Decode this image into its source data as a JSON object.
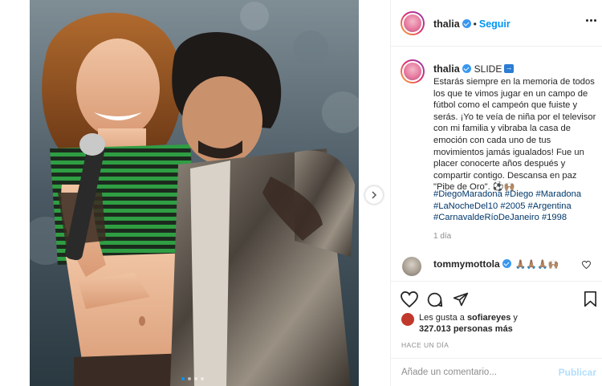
{
  "photo": {
    "slides_total": 4,
    "slide_active": 1
  },
  "header": {
    "username": "thalia",
    "separator": "•",
    "follow_label": "Seguir"
  },
  "caption": {
    "username": "thalia",
    "slide_label": "SLIDE",
    "text": "Estarás siempre en la memoria de todos los que te vimos jugar en un campo de fútbol como el campeón que fuiste y serás. ¡Yo te veía de niña por el televisor con mi familia y vibraba la casa de emoción con cada uno de tus movimientos jamás igualados! Fue un placer conocerte años después y compartir contigo. Descansa en paz \"Pibe de Oro\". ⚽🙌🏽",
    "hashtags": "#DiegoMaradona #Diego #Maradona #LaNocheDel10 #2005 #Argentina #CarnavaldeRíoDeJaneiro #1998",
    "time": "1 día"
  },
  "comment": {
    "username": "tommymottola",
    "text": "🙏🏽🙏🏽🙏🏽🙌🏽"
  },
  "likes": {
    "prefix": "Les gusta a ",
    "user": "sofiareyes",
    "joiner": " y",
    "count": "327.013 personas más"
  },
  "time_ago": "HACE UN DÍA",
  "add_comment": {
    "placeholder": "Añade un comentario...",
    "publish_label": "Publicar"
  },
  "colors": {
    "accent": "#0095f6",
    "link": "#00376b",
    "muted": "#8e8e8e",
    "publish_disabled": "#b2dffc"
  }
}
